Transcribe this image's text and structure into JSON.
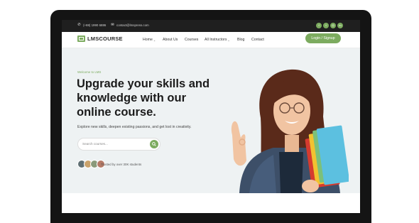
{
  "topbar": {
    "phone": "(+88) 1990 6886",
    "email": "contact@lmspress.com",
    "social_icons": [
      "facebook-icon",
      "twitter-icon",
      "instagram-icon",
      "linkedin-icon"
    ]
  },
  "navbar": {
    "logo_text": "LMSCOURSE",
    "items": [
      {
        "label": "Home",
        "dropdown": true
      },
      {
        "label": "About Us",
        "dropdown": false
      },
      {
        "label": "Courses",
        "dropdown": false
      },
      {
        "label": "All Instructors",
        "dropdown": true
      },
      {
        "label": "Blog",
        "dropdown": false
      },
      {
        "label": "Contact",
        "dropdown": false
      }
    ],
    "login_label": "Login / Signup"
  },
  "hero": {
    "eyebrow": "Welcome to LMS",
    "headline_lines": [
      "Upgrade your skills and",
      "knowledge with our",
      "online course."
    ],
    "subtext": "Explore new skills, deepen existing passions, and get lost in creativity.",
    "search_placeholder": "Search courses...",
    "trusted_text": "Trusted by over 30K students"
  },
  "colors": {
    "accent": "#7cab5f",
    "hero_bg": "#eef2f3",
    "frame": "#141414"
  }
}
